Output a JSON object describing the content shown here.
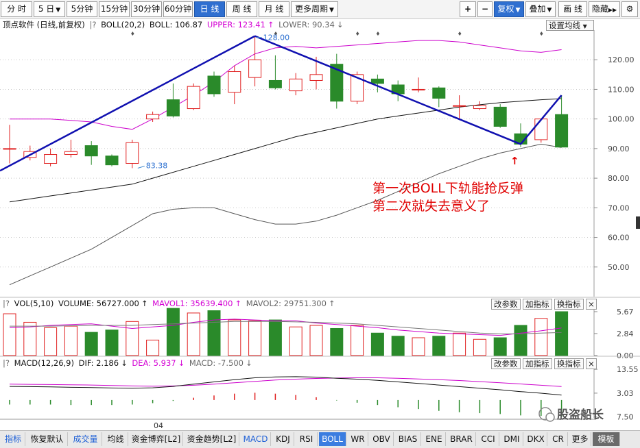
{
  "toolbar": {
    "periods": [
      {
        "label": "分 时",
        "name": "period-minute",
        "active": false
      },
      {
        "label": "5 日",
        "name": "period-5day",
        "dropdown": true,
        "active": false
      },
      {
        "label": "5分钟",
        "name": "period-5min",
        "active": false
      },
      {
        "label": "15分钟",
        "name": "period-15min",
        "active": false
      },
      {
        "label": "30分钟",
        "name": "period-30min",
        "active": false
      },
      {
        "label": "60分钟",
        "name": "period-60min",
        "active": false
      },
      {
        "label": "日 线",
        "name": "period-daily",
        "active": true
      },
      {
        "label": "周 线",
        "name": "period-weekly",
        "active": false
      },
      {
        "label": "月 线",
        "name": "period-monthly",
        "active": false
      },
      {
        "label": "更多周期",
        "name": "period-more",
        "dropdown": true,
        "active": false
      }
    ],
    "right": [
      {
        "label": "+",
        "name": "zoom-in-button",
        "active": false
      },
      {
        "label": "−",
        "name": "zoom-out-button",
        "active": false
      },
      {
        "label": "复权",
        "name": "adjust-button",
        "dropdown": true,
        "active": true
      },
      {
        "label": "叠加",
        "name": "overlay-button",
        "dropdown": true,
        "active": false
      },
      {
        "label": "画 线",
        "name": "draw-line-button",
        "active": false
      },
      {
        "label": "隐藏",
        "name": "hide-button",
        "arrow": "▶▶",
        "active": false
      }
    ]
  },
  "main_header": {
    "stock": "顶点软件 (日线,前复权)",
    "indicator": "BOLL(20,2)",
    "boll": "BOLL: 106.87",
    "upper": "UPPER: 123.41",
    "upper_arrow": "↑",
    "lower": "LOWER: 90.34",
    "lower_arrow": "↓",
    "settings_button": "设置均线"
  },
  "vol_header": {
    "indicator": "VOL(5,10)",
    "volume": "VOLUME: 56727.000",
    "volume_arrow": "↑",
    "mavol1": "MAVOL1: 35639.400",
    "mavol1_arrow": "↑",
    "mavol2": "MAVOL2: 29751.300",
    "mavol2_arrow": "↑"
  },
  "macd_header": {
    "indicator": "MACD(12,26,9)",
    "dif": "DIF: 2.186",
    "dif_arrow": "↓",
    "dea": "DEA: 5.937",
    "dea_arrow": "↓",
    "macd": "MACD: -7.500",
    "macd_arrow": "↓"
  },
  "panel_buttons": {
    "change_param": "改参数",
    "add_indicator": "加指标",
    "switch_indicator": "换指标",
    "close": "×"
  },
  "price_axis": [
    "120.00",
    "110.00",
    "100.00",
    "90.00",
    "80.00",
    "70.00",
    "60.00",
    "50.00"
  ],
  "vol_axis": [
    "5.67",
    "2.84",
    "0.00"
  ],
  "macd_axis": [
    "13.55",
    "3.03",
    "7.50"
  ],
  "date_label": "04",
  "price_labels": {
    "high": "128.00",
    "low": "83.38"
  },
  "annotation": {
    "line1": "第一次BOLL下轨能抢反弹",
    "line2": "第二次就失去意义了"
  },
  "watermark": "股盗船长",
  "colors": {
    "up": "#e02020",
    "down": "#2a8a2a",
    "trend": "#1010b0",
    "boll_outer": "#cc00cc",
    "annotation": "#e00000"
  },
  "chart_data": {
    "type": "candlestick",
    "candles": [
      {
        "o": 90,
        "c": 90,
        "h": 98,
        "l": 85
      },
      {
        "o": 87,
        "c": 89,
        "h": 91,
        "l": 86
      },
      {
        "o": 85,
        "c": 88,
        "h": 90,
        "l": 84
      },
      {
        "o": 88,
        "c": 89,
        "h": 93,
        "l": 87
      },
      {
        "o": 91,
        "c": 87.5,
        "h": 92.5,
        "l": 84.5
      },
      {
        "o": 87.5,
        "c": 84.5,
        "h": 88,
        "l": 84
      },
      {
        "o": 85,
        "c": 92,
        "h": 93,
        "l": 83.38
      },
      {
        "o": 100,
        "c": 101.5,
        "h": 102.5,
        "l": 99
      },
      {
        "o": 106.5,
        "c": 101,
        "h": 112,
        "l": 100.5
      },
      {
        "o": 103.5,
        "c": 111,
        "h": 112,
        "l": 103
      },
      {
        "o": 114.5,
        "c": 108.5,
        "h": 116,
        "l": 107.5
      },
      {
        "o": 109,
        "c": 116,
        "h": 118,
        "l": 105
      },
      {
        "o": 114,
        "c": 120,
        "h": 128,
        "l": 111
      },
      {
        "o": 113,
        "c": 110.5,
        "h": 121.5,
        "l": 110
      },
      {
        "o": 109.5,
        "c": 113.5,
        "h": 115.5,
        "l": 108
      },
      {
        "o": 113,
        "c": 115,
        "h": 121,
        "l": 110
      },
      {
        "o": 118.5,
        "c": 106,
        "h": 122,
        "l": 103.5
      },
      {
        "o": 106,
        "c": 115,
        "h": 116,
        "l": 105
      },
      {
        "o": 113.5,
        "c": 112,
        "h": 115,
        "l": 109
      },
      {
        "o": 111.5,
        "c": 108.5,
        "h": 113,
        "l": 106
      },
      {
        "o": 110,
        "c": 110,
        "h": 114,
        "l": 109
      },
      {
        "o": 110.5,
        "c": 107,
        "h": 111,
        "l": 104
      },
      {
        "o": 104.5,
        "c": 104.5,
        "h": 108,
        "l": 100
      },
      {
        "o": 103.5,
        "c": 104.5,
        "h": 106,
        "l": 103
      },
      {
        "o": 104,
        "c": 97.5,
        "h": 105,
        "l": 97
      },
      {
        "o": 95,
        "c": 91.5,
        "h": 98.5,
        "l": 90.5
      },
      {
        "o": 93,
        "c": 100,
        "h": 100,
        "l": 92
      },
      {
        "o": 101.5,
        "c": 90.5,
        "h": 108,
        "l": 90.5
      }
    ],
    "boll_mid": [
      72,
      73,
      74,
      75,
      76,
      77,
      78,
      80,
      82,
      84,
      86,
      88,
      90,
      92,
      94,
      95.5,
      97,
      98.5,
      100,
      101,
      102,
      103,
      104,
      104.8,
      105.5,
      106,
      106.5,
      106.87
    ],
    "boll_upper": [
      100,
      100,
      100,
      99.5,
      99,
      97.5,
      96.5,
      100,
      104,
      108,
      112.5,
      118,
      122,
      124,
      124.5,
      124,
      124.5,
      125,
      125.5,
      126,
      126.5,
      126.5,
      126,
      125,
      124,
      123,
      122.5,
      123.41
    ],
    "boll_lower": [
      44,
      47,
      50,
      53,
      56,
      60,
      64,
      68,
      69.5,
      70,
      70,
      68,
      66,
      64.5,
      64.5,
      65.5,
      67.5,
      70,
      72.5,
      75.5,
      78.5,
      81.5,
      84,
      86.5,
      88.5,
      90,
      91.5,
      90.34
    ],
    "trend_lines": [
      {
        "from": [
          0,
          82.5
        ],
        "to": [
          12,
          128
        ]
      },
      {
        "from": [
          12,
          128
        ],
        "to": [
          25,
          91.5
        ]
      },
      {
        "from": [
          25,
          91.5
        ],
        "to": [
          27,
          108
        ]
      }
    ],
    "volume": [
      5.4,
      4.3,
      3.6,
      3.8,
      3.0,
      3.3,
      4.4,
      2.0,
      6.1,
      5.5,
      5.8,
      4.6,
      4.5,
      4.6,
      3.7,
      3.9,
      3.5,
      3.9,
      2.9,
      2.5,
      2.3,
      2.5,
      2.9,
      2.1,
      2.3,
      3.9,
      4.8,
      5.67
    ],
    "mavol1": [
      3.6,
      3.7,
      3.9,
      4.0,
      4.1,
      3.8,
      3.5,
      3.7,
      3.9,
      4.3,
      4.6,
      4.7,
      4.6,
      4.5,
      4.5,
      4.2,
      4.0,
      3.8,
      3.6,
      3.3,
      3.1,
      2.9,
      2.8,
      2.7,
      2.6,
      2.9,
      3.2,
      3.5639
    ],
    "mavol2": [
      3.8,
      3.8,
      3.8,
      3.85,
      3.9,
      3.9,
      3.9,
      4.0,
      4.1,
      4.2,
      4.3,
      4.4,
      4.4,
      4.4,
      4.35,
      4.3,
      4.2,
      4.1,
      3.9,
      3.7,
      3.5,
      3.3,
      3.1,
      2.9,
      2.8,
      2.8,
      2.9,
      2.9751
    ],
    "dif": [
      6.0,
      5.9,
      5.8,
      5.6,
      5.5,
      5.3,
      5.2,
      5.4,
      6.0,
      7.0,
      8.0,
      9.0,
      9.8,
      10.2,
      10.3,
      10.1,
      9.6,
      9.2,
      8.7,
      8.0,
      7.3,
      6.6,
      5.9,
      5.2,
      4.5,
      3.7,
      3.0,
      2.186
    ],
    "dea": [
      7.0,
      6.9,
      6.8,
      6.7,
      6.6,
      6.4,
      6.2,
      6.1,
      6.2,
      6.5,
      7.0,
      7.6,
      8.2,
      8.8,
      9.2,
      9.5,
      9.7,
      9.8,
      9.8,
      9.6,
      9.3,
      9.0,
      8.6,
      8.1,
      7.6,
      7.1,
      6.5,
      5.937
    ],
    "macd_bar": [
      -2.0,
      -2.0,
      -2.0,
      -2.2,
      -2.2,
      -2.2,
      -2.0,
      -1.4,
      -0.4,
      1.0,
      2.0,
      2.8,
      3.2,
      2.8,
      2.2,
      1.2,
      -0.2,
      -1.2,
      -2.2,
      -3.2,
      -4.0,
      -4.8,
      -5.4,
      -5.8,
      -6.2,
      -6.8,
      -7.0,
      -7.5
    ],
    "price_ylim": [
      40,
      130
    ],
    "vol_ylim": [
      0,
      6.2
    ],
    "macd_ylim": [
      -8.5,
      14.5
    ]
  }
}
